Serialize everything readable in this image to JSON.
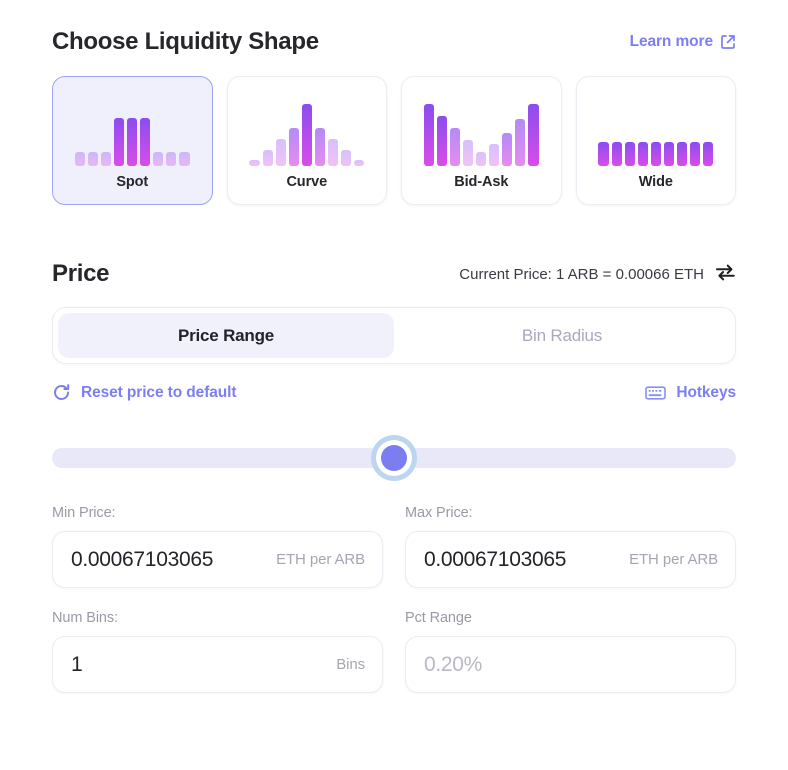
{
  "liquidity": {
    "title": "Choose Liquidity Shape",
    "learn_more": "Learn more",
    "learn_more_icon": "external-link-icon",
    "selected_shape": "Spot",
    "shapes": [
      {
        "label": "Spot",
        "selected": true,
        "bars": [
          22,
          22,
          22,
          78,
          78,
          78,
          22,
          22,
          22
        ]
      },
      {
        "label": "Curve",
        "selected": false,
        "bars": [
          10,
          26,
          44,
          62,
          100,
          62,
          44,
          26,
          10
        ]
      },
      {
        "label": "Bid-Ask",
        "selected": false,
        "bars": [
          100,
          80,
          62,
          42,
          22,
          36,
          54,
          76,
          100
        ]
      },
      {
        "label": "Wide",
        "selected": false,
        "bars": [
          38,
          38,
          38,
          38,
          38,
          38,
          38,
          38,
          38
        ]
      }
    ],
    "bar_gradient_from": "#8b4df0",
    "bar_gradient_to": "#d94de8"
  },
  "price": {
    "title": "Price",
    "current_price": "Current Price: 1 ARB = 0.00066 ETH",
    "swap_icon": "swap-arrows-icon",
    "tabs": [
      {
        "label": "Price Range",
        "active": true
      },
      {
        "label": "Bin Radius",
        "active": false
      }
    ],
    "reset": {
      "label": "Reset price to default",
      "icon": "refresh-icon"
    },
    "hotkeys": {
      "label": "Hotkeys",
      "icon": "keyboard-icon"
    },
    "slider": {
      "value_percent": 50
    },
    "fields": [
      {
        "label": "Min Price:",
        "value": "0.00067103065",
        "suffix": "ETH per ARB",
        "muted": false
      },
      {
        "label": "Max Price:",
        "value": "0.00067103065",
        "suffix": "ETH per ARB",
        "muted": false
      },
      {
        "label": "Num Bins:",
        "value": "1",
        "suffix": "Bins",
        "muted": false
      },
      {
        "label": "Pct Range",
        "value": "0.20%",
        "suffix": "",
        "muted": true
      }
    ]
  },
  "colors": {
    "accent_purple": "#7c7ff0",
    "text_dark": "#26272b",
    "text_muted": "#9a9aa6",
    "selected_card_bg": "#f0f0fd",
    "slider_track": "#e8e8f8",
    "slider_thumb": "#7b7ef0"
  }
}
